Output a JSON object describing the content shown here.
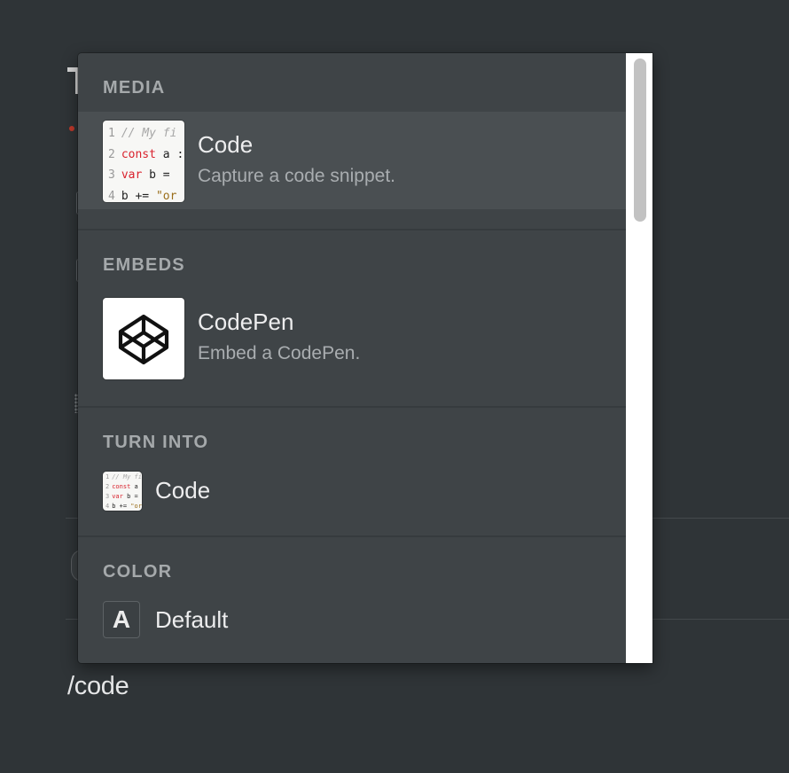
{
  "background": {
    "command_text": "/code"
  },
  "menu": {
    "sections": [
      {
        "header": "MEDIA",
        "items": [
          {
            "title": "Code",
            "description": "Capture a code snippet.",
            "icon": "code-snippet-thumbnail",
            "selected": true
          }
        ]
      },
      {
        "header": "EMBEDS",
        "items": [
          {
            "title": "CodePen",
            "description": "Embed a CodePen.",
            "icon": "codepen-logo-icon"
          }
        ]
      },
      {
        "header": "TURN INTO",
        "items": [
          {
            "title": "Code",
            "icon": "code-snippet-thumbnail"
          }
        ]
      },
      {
        "header": "COLOR",
        "items": [
          {
            "title": "Default",
            "icon": "letter-a-icon",
            "glyph": "A"
          }
        ]
      }
    ]
  },
  "code_thumbnail_lines": [
    {
      "num": "1",
      "text": "// My fi"
    },
    {
      "num": "2",
      "kw": "const",
      "rest": " a :"
    },
    {
      "num": "3",
      "kw": "var",
      "rest": " b ="
    },
    {
      "num": "4",
      "pre": "b += ",
      "str": "\"or"
    }
  ],
  "colors": {
    "background": "#2f3437",
    "menu_background": "#3f4447",
    "selected_row": "#4a4f52",
    "section_header": "#a5a9ab",
    "scrollbar_track": "#ffffff",
    "scrollbar_thumb": "#c2c2c2"
  }
}
